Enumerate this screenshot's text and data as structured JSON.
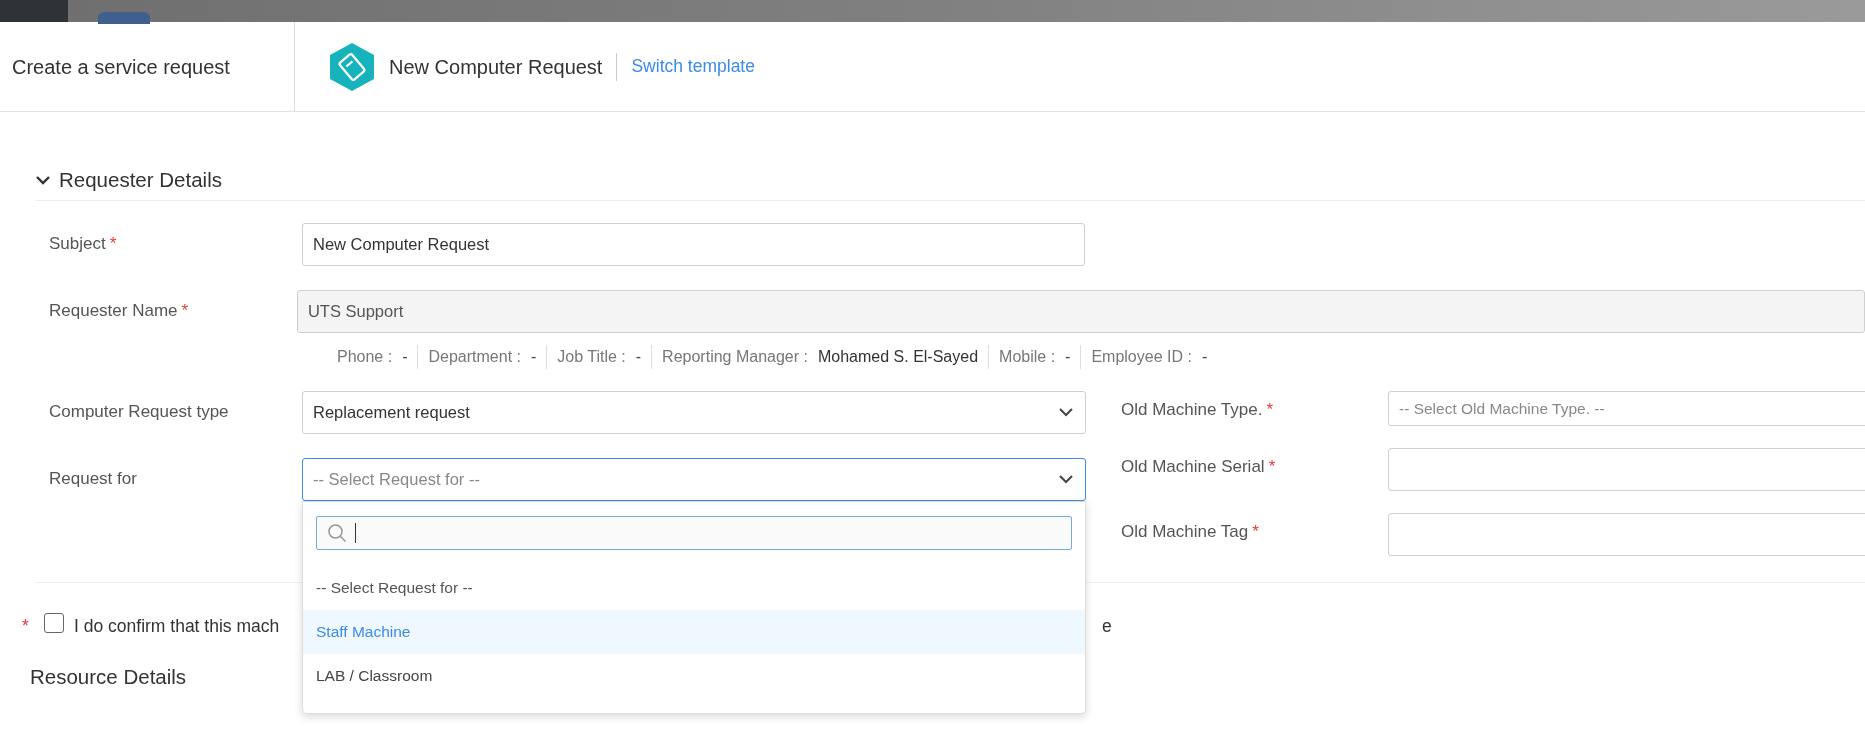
{
  "header": {
    "title": "Create a service request",
    "template_name": "New Computer Request",
    "switch_link": "Switch template"
  },
  "requester_section": {
    "title": "Requester Details",
    "expanded": true,
    "subject": {
      "label": "Subject",
      "required_mark": "*",
      "value": "New Computer Request"
    },
    "requester_name": {
      "label": "Requester Name",
      "required_mark": "*",
      "value": "UTS Support",
      "disabled": true
    },
    "requester_info": [
      {
        "label": "Phone :",
        "value": "-"
      },
      {
        "label": "Department :",
        "value": "-"
      },
      {
        "label": "Job Title :",
        "value": "-"
      },
      {
        "label": "Reporting Manager :",
        "value": "Mohamed S. El-Sayed"
      },
      {
        "label": "Mobile :",
        "value": "-"
      },
      {
        "label": "Employee ID :",
        "value": "-"
      }
    ],
    "left_fields": [
      {
        "kind": "select",
        "label": "Computer Request type",
        "value": "Replacement request"
      },
      {
        "kind": "select",
        "label": "Request for",
        "placeholder": "-- Select Request for --",
        "open": true
      }
    ],
    "right_fields": [
      {
        "kind": "select",
        "label": "Old Machine Type.",
        "required_mark": "*",
        "placeholder": "-- Select Old Machine Type. --"
      },
      {
        "kind": "text",
        "label": "Old Machine Serial",
        "required_mark": "*"
      },
      {
        "kind": "text",
        "label": "Old Machine Tag",
        "required_mark": "*"
      }
    ]
  },
  "dropdown": {
    "options": [
      {
        "label": "-- Select Request for --",
        "highlighted": false,
        "kind": "placeholder"
      },
      {
        "label": "Staff Machine",
        "highlighted": true,
        "kind": "option"
      },
      {
        "label": "LAB / Classroom",
        "highlighted": false,
        "kind": "option"
      }
    ]
  },
  "confirm": {
    "required_mark": "*",
    "checked": false,
    "text_before": "I do confirm that this mach",
    "text_after": "e"
  },
  "resource_section": {
    "title": "Resource Details"
  }
}
